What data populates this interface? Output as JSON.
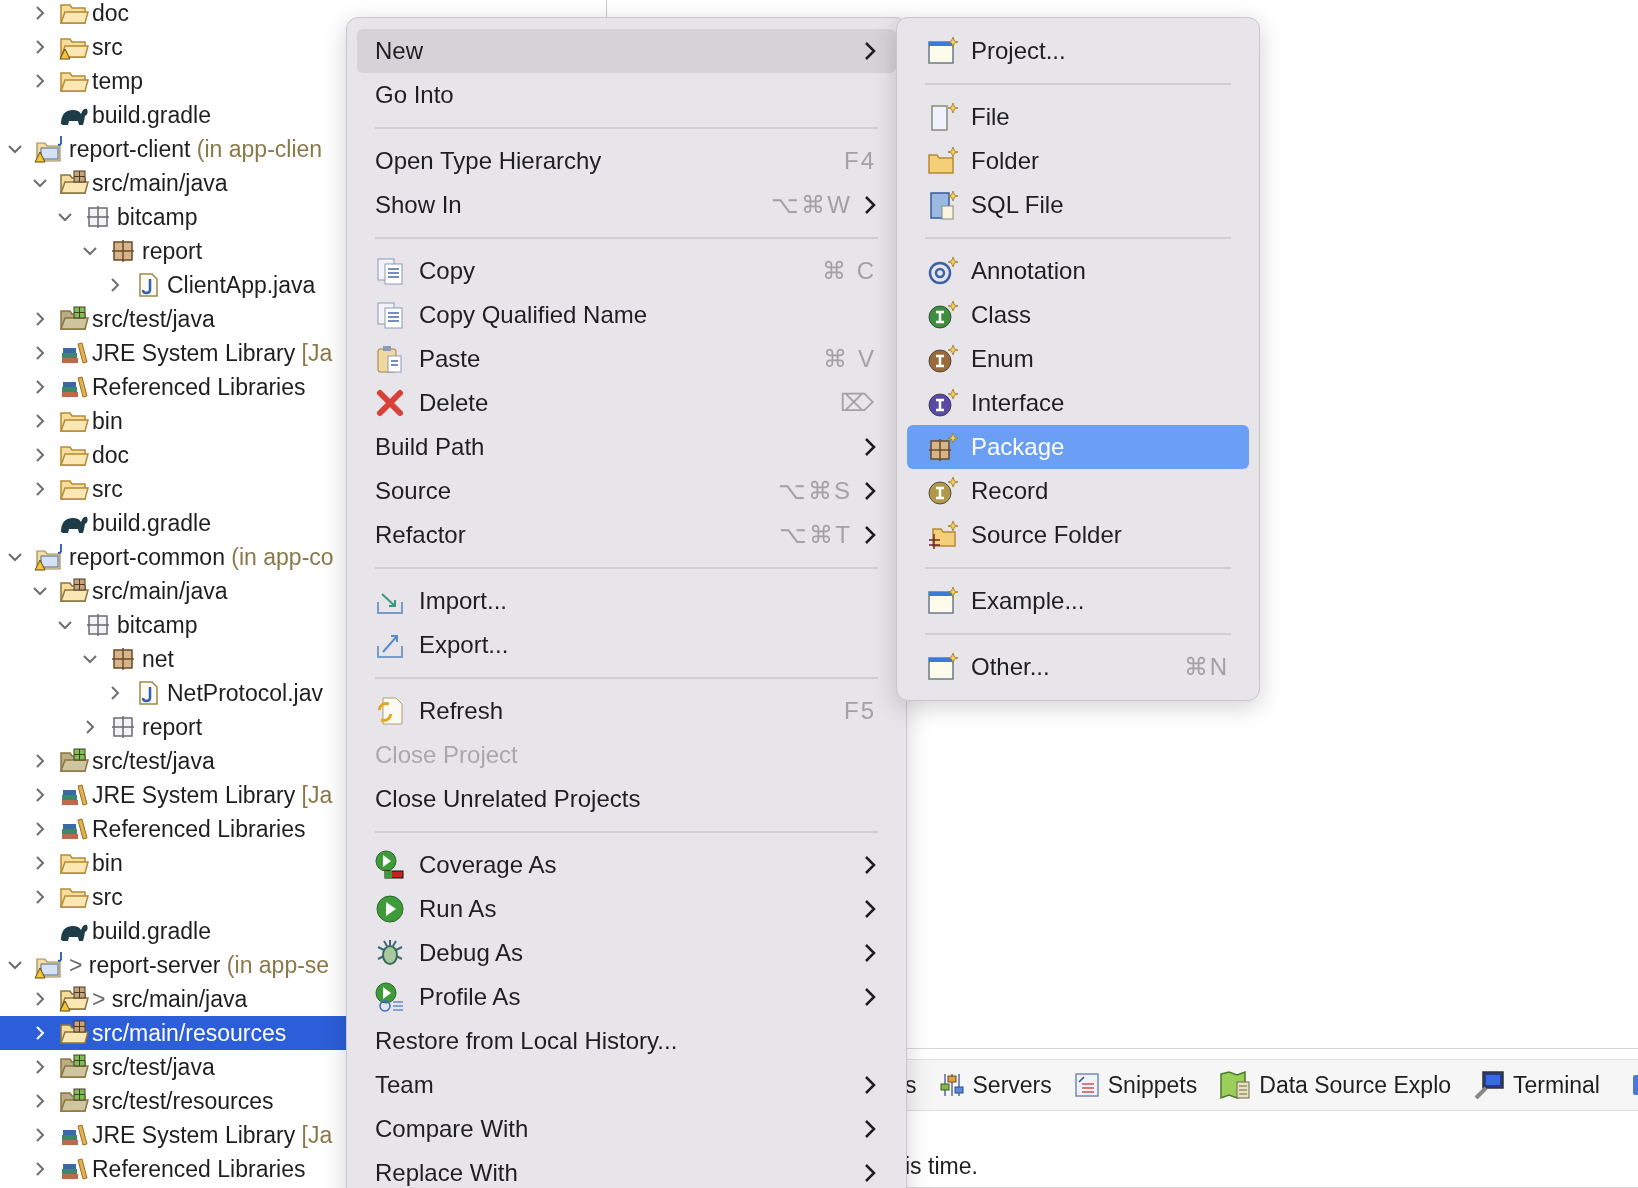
{
  "explorer": {
    "above_items": [
      {
        "label": "doc",
        "kind": "folder",
        "expanded": false,
        "selected": false
      },
      {
        "label": "src",
        "kind": "folder",
        "expanded": false,
        "selected": false,
        "warning": true
      },
      {
        "label": "temp",
        "kind": "folder",
        "expanded": false,
        "selected": false
      },
      {
        "label": "build.gradle",
        "kind": "gradle",
        "selected": false
      }
    ],
    "projects": [
      {
        "label": "report-client",
        "suffix": "(in app-clien",
        "kind": "project",
        "expanded": true,
        "selected": false,
        "warning": true,
        "children": [
          {
            "label": "src/main/java",
            "kind": "source-folder",
            "expanded": true,
            "selected": false,
            "children": [
              {
                "label": "bitcamp",
                "kind": "empty-package",
                "expanded": true,
                "selected": false,
                "children": [
                  {
                    "label": "report",
                    "kind": "package",
                    "expanded": true,
                    "selected": false,
                    "children": [
                      {
                        "label": "ClientApp.java",
                        "kind": "java-file",
                        "expanded": false,
                        "selected": false
                      }
                    ]
                  }
                ]
              }
            ]
          },
          {
            "label": "src/test/java",
            "kind": "test-folder",
            "expanded": false,
            "selected": false
          },
          {
            "label": "JRE System Library",
            "suffix": "[Ja",
            "kind": "library",
            "expanded": false,
            "selected": false
          },
          {
            "label": "Referenced Libraries",
            "kind": "library",
            "expanded": false,
            "selected": false
          },
          {
            "label": "bin",
            "kind": "folder",
            "expanded": false,
            "selected": false
          },
          {
            "label": "doc",
            "kind": "folder",
            "expanded": false,
            "selected": false
          },
          {
            "label": "src",
            "kind": "folder",
            "expanded": false,
            "selected": false
          },
          {
            "label": "build.gradle",
            "kind": "gradle",
            "selected": false
          }
        ]
      },
      {
        "label": "report-common",
        "suffix": "(in app-co",
        "kind": "project",
        "expanded": true,
        "selected": false,
        "warning": true,
        "children": [
          {
            "label": "src/main/java",
            "kind": "source-folder",
            "expanded": true,
            "selected": false,
            "children": [
              {
                "label": "bitcamp",
                "kind": "empty-package",
                "expanded": true,
                "selected": false,
                "children": [
                  {
                    "label": "net",
                    "kind": "package",
                    "expanded": true,
                    "selected": false,
                    "children": [
                      {
                        "label": "NetProtocol.jav",
                        "kind": "java-file",
                        "expanded": false,
                        "selected": false
                      }
                    ]
                  },
                  {
                    "label": "report",
                    "kind": "empty-package",
                    "expanded": false,
                    "selected": false
                  }
                ]
              }
            ]
          },
          {
            "label": "src/test/java",
            "kind": "test-folder",
            "expanded": false,
            "selected": false
          },
          {
            "label": "JRE System Library",
            "suffix": "[Ja",
            "kind": "library",
            "expanded": false,
            "selected": false
          },
          {
            "label": "Referenced Libraries",
            "kind": "library",
            "expanded": false,
            "selected": false
          },
          {
            "label": "bin",
            "kind": "folder",
            "expanded": false,
            "selected": false
          },
          {
            "label": "src",
            "kind": "folder",
            "expanded": false,
            "selected": false
          },
          {
            "label": "build.gradle",
            "kind": "gradle",
            "selected": false
          }
        ]
      },
      {
        "label": "report-server",
        "prefix": ">",
        "suffix": "(in app-se",
        "kind": "project",
        "expanded": true,
        "selected": false,
        "warning": true,
        "children": [
          {
            "label": "src/main/java",
            "prefix": ">",
            "kind": "source-folder",
            "expanded": false,
            "selected": false,
            "warning": true
          },
          {
            "label": "src/main/resources",
            "kind": "source-folder",
            "expanded": false,
            "selected": true
          },
          {
            "label": "src/test/java",
            "kind": "test-folder",
            "expanded": false,
            "selected": false
          },
          {
            "label": "src/test/resources",
            "kind": "test-folder",
            "expanded": false,
            "selected": false
          },
          {
            "label": "JRE System Library",
            "suffix": "[Ja",
            "kind": "library",
            "expanded": false,
            "selected": false
          },
          {
            "label": "Referenced Libraries",
            "kind": "library",
            "expanded": false,
            "selected": false
          }
        ]
      }
    ]
  },
  "context_menu": {
    "items": [
      {
        "kind": "item",
        "label": "New",
        "submenu": true,
        "selected": true,
        "disabled": false
      },
      {
        "kind": "item",
        "label": "Go Into",
        "selected": false,
        "disabled": false
      },
      {
        "kind": "separator"
      },
      {
        "kind": "item",
        "label": "Open Type Hierarchy",
        "shortcut": "F4",
        "selected": false,
        "disabled": false
      },
      {
        "kind": "item",
        "label": "Show In",
        "shortcut": "⌥⌘W",
        "submenu": true,
        "selected": false,
        "disabled": false
      },
      {
        "kind": "separator"
      },
      {
        "kind": "copy",
        "label": "Copy",
        "shortcut": "⌘ C",
        "selected": false,
        "disabled": false
      },
      {
        "kind": "copy-name",
        "label": "Copy Qualified Name",
        "selected": false,
        "disabled": false
      },
      {
        "kind": "paste",
        "label": "Paste",
        "shortcut": "⌘ V",
        "selected": false,
        "disabled": false
      },
      {
        "kind": "delete",
        "label": "Delete",
        "shortcut": "⌦",
        "selected": false,
        "disabled": false
      },
      {
        "kind": "item",
        "label": "Build Path",
        "submenu": true,
        "selected": false,
        "disabled": false
      },
      {
        "kind": "item",
        "label": "Source",
        "shortcut": "⌥⌘S",
        "submenu": true,
        "selected": false,
        "disabled": false
      },
      {
        "kind": "item",
        "label": "Refactor",
        "shortcut": "⌥⌘T",
        "submenu": true,
        "selected": false,
        "disabled": false
      },
      {
        "kind": "separator"
      },
      {
        "kind": "import",
        "label": "Import...",
        "selected": false,
        "disabled": false
      },
      {
        "kind": "export",
        "label": "Export...",
        "selected": false,
        "disabled": false
      },
      {
        "kind": "separator"
      },
      {
        "kind": "refresh",
        "label": "Refresh",
        "shortcut": "F5",
        "selected": false,
        "disabled": false
      },
      {
        "kind": "item",
        "label": "Close Project",
        "selected": false,
        "disabled": true
      },
      {
        "kind": "item",
        "label": "Close Unrelated Projects",
        "selected": false,
        "disabled": false
      },
      {
        "kind": "separator"
      },
      {
        "kind": "coverage",
        "label": "Coverage As",
        "submenu": true,
        "selected": false,
        "disabled": false
      },
      {
        "kind": "run",
        "label": "Run As",
        "submenu": true,
        "selected": false,
        "disabled": false
      },
      {
        "kind": "debug",
        "label": "Debug As",
        "submenu": true,
        "selected": false,
        "disabled": false
      },
      {
        "kind": "profile",
        "label": "Profile As",
        "submenu": true,
        "selected": false,
        "disabled": false
      },
      {
        "kind": "item",
        "label": "Restore from Local History...",
        "selected": false,
        "disabled": false
      },
      {
        "kind": "item",
        "label": "Team",
        "submenu": true,
        "selected": false,
        "disabled": false
      },
      {
        "kind": "item",
        "label": "Compare With",
        "submenu": true,
        "selected": false,
        "disabled": false
      },
      {
        "kind": "item",
        "label": "Replace With",
        "submenu": true,
        "selected": false,
        "disabled": false
      }
    ]
  },
  "new_submenu": {
    "items": [
      {
        "kind": "wizard",
        "label": "Project...",
        "selected": false
      },
      {
        "kind": "separator"
      },
      {
        "kind": "file",
        "label": "File",
        "selected": false
      },
      {
        "kind": "folder",
        "label": "Folder",
        "selected": false
      },
      {
        "kind": "sql",
        "label": "SQL File",
        "selected": false
      },
      {
        "kind": "separator"
      },
      {
        "kind": "annotation",
        "label": "Annotation",
        "selected": false
      },
      {
        "kind": "class",
        "label": "Class",
        "selected": false
      },
      {
        "kind": "enum",
        "label": "Enum",
        "selected": false
      },
      {
        "kind": "interface",
        "label": "Interface",
        "selected": false
      },
      {
        "kind": "package",
        "label": "Package",
        "selected": true
      },
      {
        "kind": "record",
        "label": "Record",
        "selected": false
      },
      {
        "kind": "source-folder",
        "label": "Source Folder",
        "selected": false
      },
      {
        "kind": "separator"
      },
      {
        "kind": "wizard",
        "label": "Example...",
        "selected": false
      },
      {
        "kind": "separator"
      },
      {
        "kind": "wizard",
        "label": "Other...",
        "shortcut": "⌘N",
        "selected": false
      }
    ]
  },
  "bottom_panel": {
    "tabs": [
      {
        "kind": "plain",
        "label": "s"
      },
      {
        "kind": "servers",
        "label": "Servers"
      },
      {
        "kind": "snippets",
        "label": "Snippets"
      },
      {
        "kind": "data-source",
        "label": "Data Source Explo"
      },
      {
        "kind": "terminal",
        "label": "Terminal"
      }
    ],
    "message": "is time."
  }
}
